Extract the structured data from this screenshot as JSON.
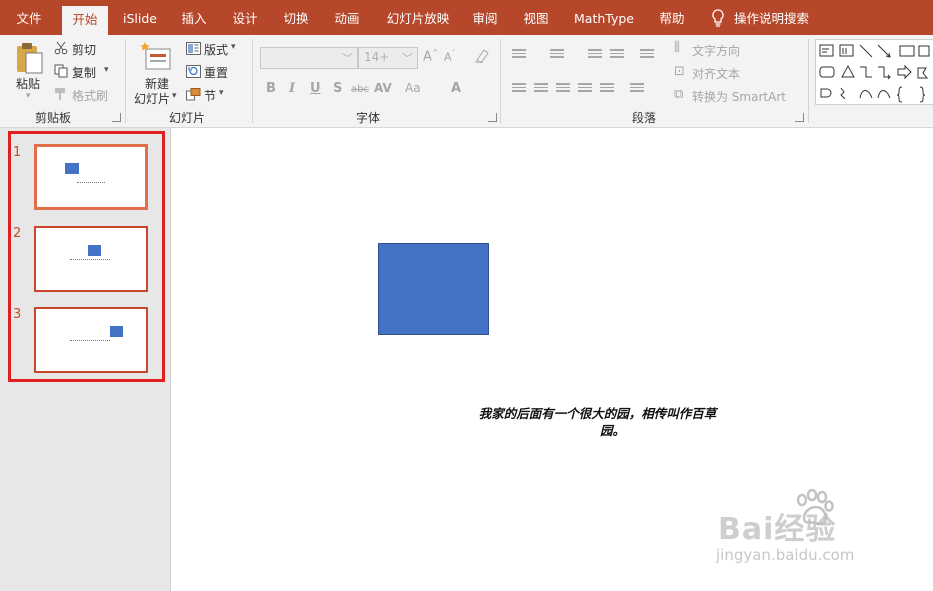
{
  "tabs": [
    "文件",
    "开始",
    "iSlide",
    "插入",
    "设计",
    "切换",
    "动画",
    "幻灯片放映",
    "审阅",
    "视图",
    "MathType",
    "帮助"
  ],
  "active_tab": "开始",
  "tell_me": "操作说明搜索",
  "clipboard": {
    "paste": "粘贴",
    "cut": "剪切",
    "copy": "复制",
    "format_painter": "格式刷",
    "label": "剪贴板"
  },
  "slides_group": {
    "new_slide_1": "新建",
    "new_slide_2": "幻灯片",
    "layout": "版式",
    "reset": "重置",
    "section": "节",
    "label": "幻灯片"
  },
  "font_group": {
    "font_size": "14+",
    "label": "字体",
    "buttons": [
      "B",
      "I",
      "U",
      "S",
      "abc",
      "AV",
      "Aa",
      "A"
    ]
  },
  "paragraph_group": {
    "text_direction": "文字方向",
    "align_text": "对齐文本",
    "convert_smartart": "转换为 SmartArt",
    "label": "段落"
  },
  "slide_numbers": [
    "1",
    "2",
    "3"
  ],
  "slide_text_line1": "我家的后面有一个很大的园，相传叫作百草",
  "slide_text_line2": "园。",
  "watermark": {
    "brand": "Bai经验",
    "url": "jingyan.baidu.com"
  },
  "colors": {
    "accent": "#b7472a",
    "shape_fill": "#4472c4",
    "selection": "#e02020"
  }
}
